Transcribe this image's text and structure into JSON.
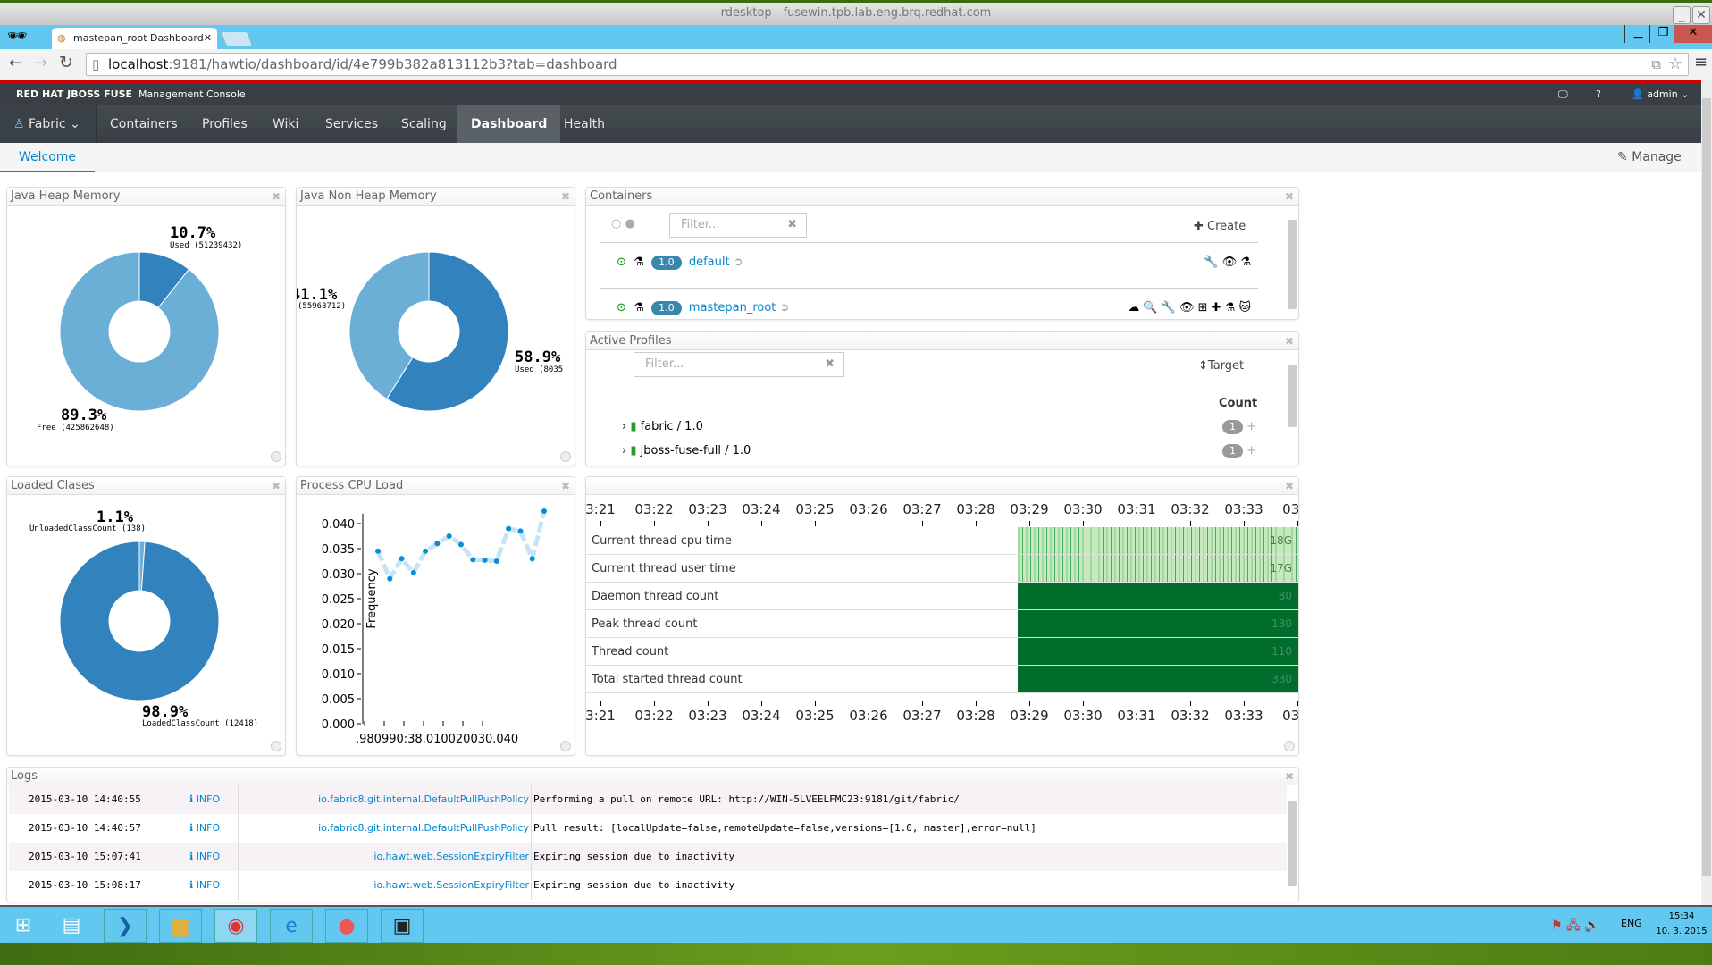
{
  "window": {
    "title": "rdesktop - fusewin.tpb.lab.eng.brq.redhat.com"
  },
  "browser": {
    "tab_title": "mastepan_root Dashboard",
    "url_host": "localhost",
    "url_rest": ":9181/hawtio/dashboard/id/4e799b382a813112b3?tab=dashboard"
  },
  "header": {
    "brand": "RED HAT JBOSS FUSE",
    "subtitle": "Management Console",
    "user": "admin"
  },
  "nav": {
    "items": [
      "Fabric",
      "Containers",
      "Profiles",
      "Wiki",
      "Services",
      "Scaling",
      "Dashboard",
      "Health"
    ],
    "active": "Dashboard"
  },
  "subnav": {
    "welcome": "Welcome",
    "manage": "Manage"
  },
  "colors": {
    "dark_slice": "#3182bd",
    "light_slice": "#6baed6",
    "accent": "#0088ce",
    "thread_green": "#006d2c"
  },
  "heap": {
    "title": "Java Heap Memory",
    "slices": [
      {
        "pct": 10.7,
        "label": "10.7%",
        "caption": "Used (51239432)"
      },
      {
        "pct": 89.3,
        "label": "89.3%",
        "caption": "Free (425862648)"
      }
    ]
  },
  "nonheap": {
    "title": "Java Non Heap Memory",
    "slices": [
      {
        "pct": 58.9,
        "label": "58.9%",
        "caption": "Used (8035"
      },
      {
        "pct": 41.1,
        "label": "41.1%",
        "caption": "(55963712)"
      }
    ]
  },
  "classes": {
    "title": "Loaded Clases",
    "slices": [
      {
        "pct": 1.1,
        "label": "1.1%",
        "caption": "UnloadedClassCount (138)"
      },
      {
        "pct": 98.9,
        "label": "98.9%",
        "caption": "LoadedClassCount (12418)"
      }
    ]
  },
  "containers": {
    "title": "Containers",
    "filter_placeholder": "Filter...",
    "create": "Create",
    "rows": [
      {
        "version": "1.0",
        "name": "default"
      },
      {
        "version": "1.0",
        "name": "mastepan_root"
      }
    ]
  },
  "profiles": {
    "title": "Active Profiles",
    "filter_placeholder": "Filter...",
    "target": "Target",
    "count_header": "Count",
    "rows": [
      {
        "name": "fabric / 1.0",
        "count": "1"
      },
      {
        "name": "jboss-fuse-full / 1.0",
        "count": "1"
      }
    ]
  },
  "cpu": {
    "title": "Process CPU Load"
  },
  "chart_data": {
    "type": "line",
    "title": "Process CPU Load",
    "ylabel": "Frequency",
    "ylim": [
      0,
      0.042
    ],
    "yticks": [
      "0.000",
      "0.005",
      "0.010",
      "0.015",
      "0.020",
      "0.025",
      "0.030",
      "0.035",
      "0.040"
    ],
    "xtick_text": ".980990:38.010020030.040",
    "values": [
      0.0345,
      0.029,
      0.033,
      0.0302,
      0.0345,
      0.036,
      0.0375,
      0.0358,
      0.0328,
      0.0327,
      0.0325,
      0.039,
      0.0385,
      0.033,
      0.0425
    ]
  },
  "threads": {
    "times": [
      "3:21",
      "03:22",
      "03:23",
      "03:24",
      "03:25",
      "03:26",
      "03:27",
      "03:28",
      "03:29",
      "03:30",
      "03:31",
      "03:32",
      "03:33",
      "03:3"
    ],
    "rows": [
      {
        "label": "Current thread cpu time",
        "value": "18G"
      },
      {
        "label": "Current thread user time",
        "value": "17G"
      },
      {
        "label": "Daemon thread count",
        "value": "80"
      },
      {
        "label": "Peak thread count",
        "value": "130"
      },
      {
        "label": "Thread count",
        "value": "110"
      },
      {
        "label": "Total started thread count",
        "value": "330"
      }
    ]
  },
  "logs": {
    "title": "Logs",
    "rows": [
      {
        "time": "2015-03-10 14:40:55",
        "level": "INFO",
        "logger": "io.fabric8.git.internal.DefaultPullPushPolicy",
        "message": "Performing a pull on remote URL: http://WIN-5LVEELFMC23:9181/git/fabric/"
      },
      {
        "time": "2015-03-10 14:40:57",
        "level": "INFO",
        "logger": "io.fabric8.git.internal.DefaultPullPushPolicy",
        "message": "Pull result: [localUpdate=false,remoteUpdate=false,versions=[1.0, master],error=null]"
      },
      {
        "time": "2015-03-10 15:07:41",
        "level": "INFO",
        "logger": "io.hawt.web.SessionExpiryFilter",
        "message": "Expiring session due to inactivity"
      },
      {
        "time": "2015-03-10 15:08:17",
        "level": "INFO",
        "logger": "io.hawt.web.SessionExpiryFilter",
        "message": "Expiring session due to inactivity"
      }
    ]
  },
  "taskbar": {
    "lang": "ENG",
    "time": "15:34",
    "date": "10. 3. 2015"
  }
}
